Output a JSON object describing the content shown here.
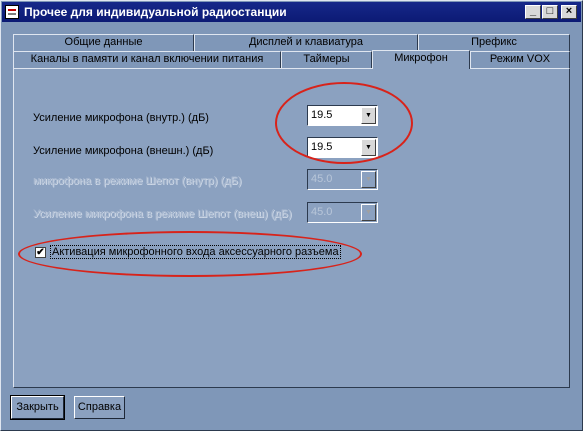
{
  "window": {
    "title": "Прочее для индивидуальной радиостанции",
    "controls": {
      "minimize": "_",
      "maximize": "□",
      "close": "×"
    }
  },
  "tabs": {
    "row_back": [
      "Общие данные",
      "Дисплей и клавиатура",
      "Префикс"
    ],
    "row_front": [
      "Каналы в памяти и канал включении питания",
      "Таймеры",
      "Микрофон",
      "Режим VOX"
    ],
    "active": "Микрофон"
  },
  "fields": [
    {
      "label": "Усиление микрофона (внутр.) (дБ)",
      "value": "19.5",
      "enabled": true
    },
    {
      "label": "Усиление микрофона (внешн.) (дБ)",
      "value": "19.5",
      "enabled": true
    },
    {
      "label": "микрофона в режиме Шепот (внутр) (дБ)",
      "value": "45.0",
      "enabled": false
    },
    {
      "label": "Усиление микрофона в режиме Шепот (внеш) (дБ)",
      "value": "45.0",
      "enabled": false
    }
  ],
  "checkbox": {
    "label": "Активация микрофонного входа аксессуарного разъема",
    "checked": true,
    "mark": "✔"
  },
  "combo_arrow": "▼",
  "buttons": {
    "close": "Закрыть",
    "help": "Справка"
  },
  "colors": {
    "highlight_ellipse": "#d8231a",
    "titlebar": "#0c1a74",
    "window_bg": "#7f97b8"
  }
}
